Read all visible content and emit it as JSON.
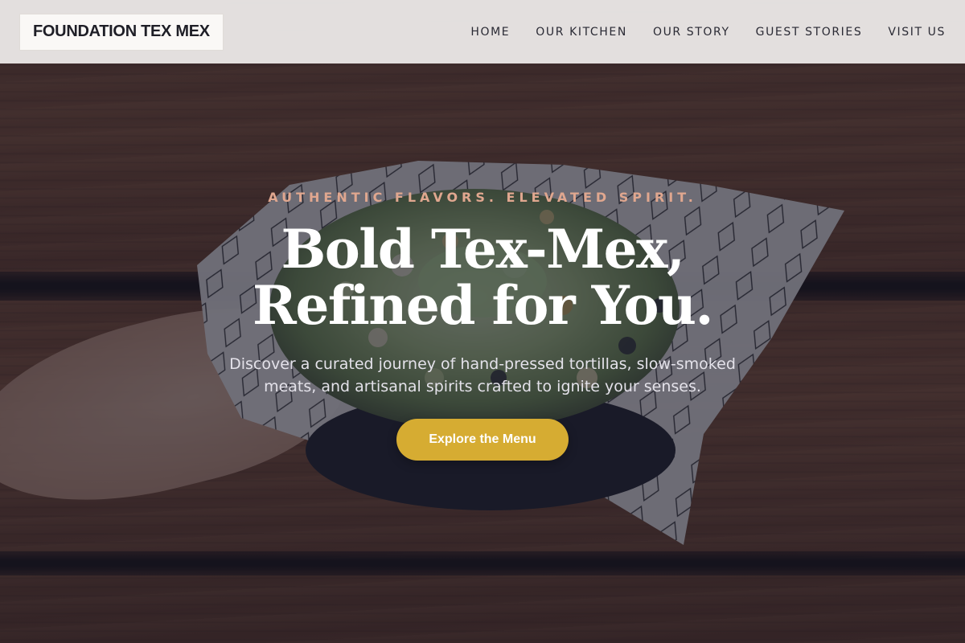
{
  "nav": {
    "brand": "FOUNDATION TEX MEX",
    "links": [
      "HOME",
      "OUR KITCHEN",
      "OUR STORY",
      "GUEST STORIES",
      "VISIT US"
    ]
  },
  "hero": {
    "eyebrow": "AUTHENTIC FLAVORS. ELEVATED SPIRIT.",
    "headline_line1": "Bold Tex-Mex,",
    "headline_line2": "Refined for You.",
    "subtext": "Discover a curated journey of hand-pressed tortillas, slow-smoked meats, and artisanal spirits crafted to ignite your senses.",
    "cta_label": "Explore the Menu",
    "background_image": "hand-holding-bowl-on-wood-table"
  },
  "colors": {
    "accent": "#d6ac32",
    "eyebrow": "#e0a78f",
    "overlay": "#181a2c",
    "nav_bg": "#ece9e8"
  }
}
